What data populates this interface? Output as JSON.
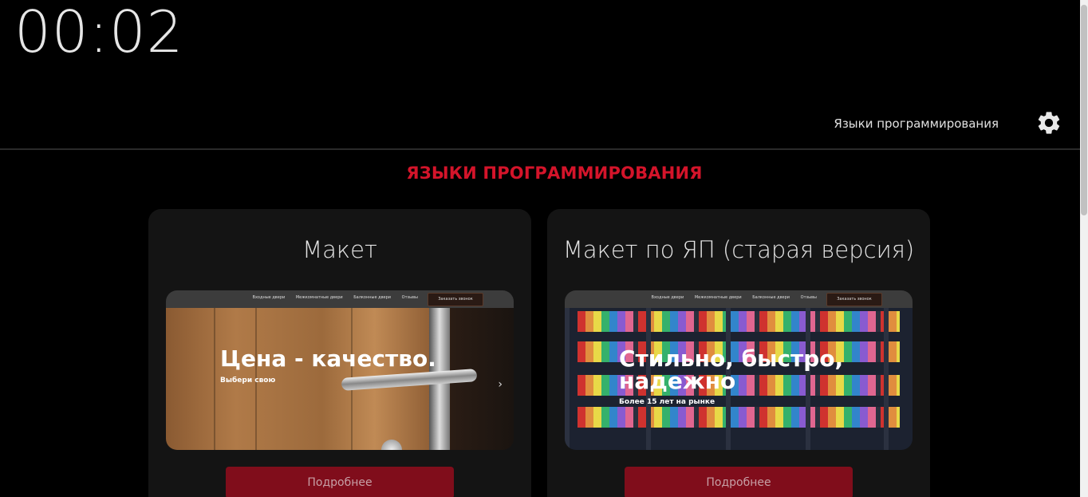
{
  "timer": "00:02",
  "header": {
    "nav_link": "Языки программирования",
    "settings_icon": "gear-icon"
  },
  "section": {
    "title": "ЯЗЫКИ ПРОГРАММИРОВАНИЯ"
  },
  "cards": [
    {
      "title": "Макет",
      "preview": {
        "nav": [
          "Входные двери",
          "Межкомнатные двери",
          "Балконные двери",
          "Отзывы"
        ],
        "button": "Заказать звонок",
        "hero_title": "Цена - качество.",
        "hero_subtitle": "Выбери свою"
      },
      "button": "Подробнее"
    },
    {
      "title": "Макет по ЯП (старая версия)",
      "preview": {
        "nav": [
          "Входные двери",
          "Межкомнатные двери",
          "Балконные двери",
          "Отзывы"
        ],
        "button": "Заказать звонок",
        "hero_title_line1": "Стильно, быстро,",
        "hero_title_line2": "надежно",
        "hero_subtitle": "Более 15 лет на рынке"
      },
      "button": "Подробнее"
    }
  ],
  "colors": {
    "accent_red": "#d4142a",
    "button_bg": "#800d1b",
    "card_bg": "#141414",
    "page_bg": "#000000"
  }
}
